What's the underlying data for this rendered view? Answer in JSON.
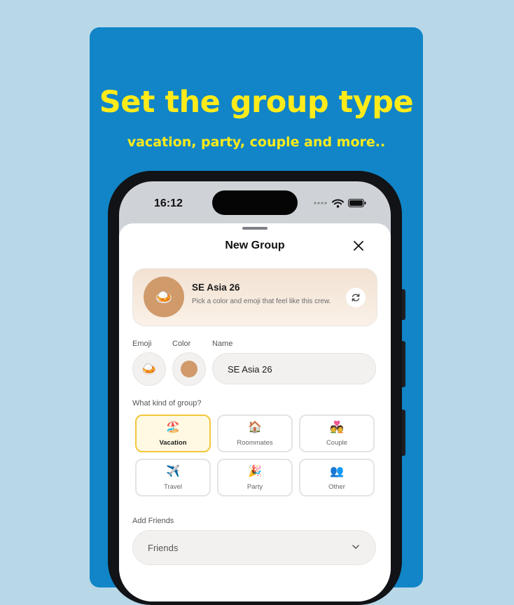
{
  "promo": {
    "headline": "Set the group type",
    "subline": "vacation, party, couple and more.."
  },
  "status_bar": {
    "time": "16:12"
  },
  "sheet": {
    "title": "New Group",
    "close_icon": "close-icon"
  },
  "preview": {
    "emoji": "🍛",
    "name": "SE Asia 26",
    "description": "Pick a color and emoji that feel like this crew.",
    "refresh_icon": "refresh-icon",
    "avatar_color": "#d09a6b"
  },
  "fields": {
    "emoji_label": "Emoji",
    "emoji_value": "🍛",
    "color_label": "Color",
    "color_value": "#d09a6b",
    "name_label": "Name",
    "name_value": "SE Asia 26"
  },
  "group_kind": {
    "label": "What kind of group?",
    "selected": "Vacation",
    "options": [
      {
        "emoji": "🏖️",
        "label": "Vacation"
      },
      {
        "emoji": "🏠",
        "label": "Roommates"
      },
      {
        "emoji": "💑",
        "label": "Couple"
      },
      {
        "emoji": "✈️",
        "label": "Travel"
      },
      {
        "emoji": "🎉",
        "label": "Party"
      },
      {
        "emoji": "👥",
        "label": "Other"
      }
    ]
  },
  "friends": {
    "label": "Add Friends",
    "placeholder": "Friends"
  },
  "colors": {
    "background": "#b8d8e8",
    "card": "#1185c7",
    "headline": "#ffeb1a",
    "selected_border": "#f4c63b"
  }
}
